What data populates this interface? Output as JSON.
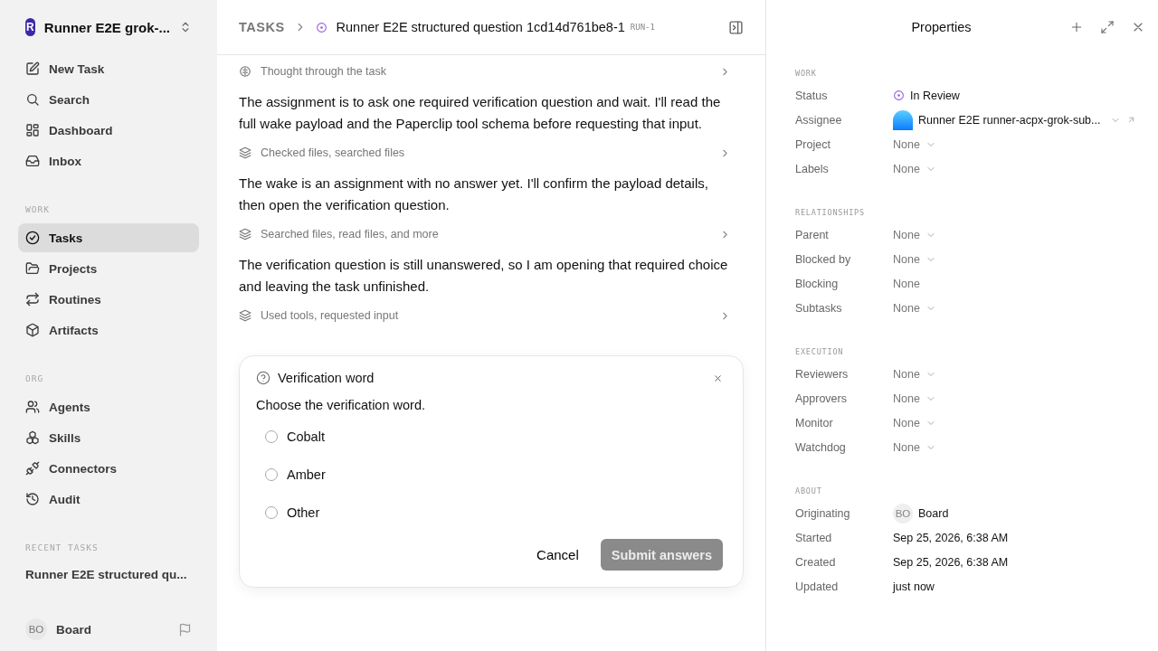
{
  "sidebar": {
    "workspace": {
      "initial": "R",
      "name": "Runner E2E grok-..."
    },
    "nav": [
      {
        "label": "New Task",
        "selected": false
      },
      {
        "label": "Search",
        "selected": false
      },
      {
        "label": "Dashboard",
        "selected": false
      },
      {
        "label": "Inbox",
        "selected": false
      }
    ],
    "sections": [
      {
        "title": "WORK",
        "items": [
          {
            "label": "Tasks",
            "selected": true
          },
          {
            "label": "Projects",
            "selected": false
          },
          {
            "label": "Routines",
            "selected": false
          },
          {
            "label": "Artifacts",
            "selected": false
          }
        ]
      },
      {
        "title": "ORG",
        "items": [
          {
            "label": "Agents",
            "selected": false
          },
          {
            "label": "Skills",
            "selected": false
          },
          {
            "label": "Connectors",
            "selected": false
          },
          {
            "label": "Audit",
            "selected": false
          }
        ]
      }
    ],
    "recent": {
      "title": "RECENT TASKS",
      "items": [
        {
          "label": "Runner E2E structured qu..."
        }
      ]
    },
    "user": {
      "initials": "BO",
      "name": "Board"
    }
  },
  "header": {
    "breadcrumb": "TASKS",
    "title": "Runner E2E structured question 1cd14d761be8-1",
    "run_id": "RUN-1"
  },
  "transcript": [
    {
      "kind": "thought",
      "label": "Thought through the task"
    },
    {
      "kind": "message",
      "text": "The assignment is to ask one required verification question and wait. I'll read the full wake payload and the Paperclip tool schema before requesting that input."
    },
    {
      "kind": "tools",
      "label": "Checked files, searched files"
    },
    {
      "kind": "message",
      "text": "The wake is an assignment with no answer yet. I'll confirm the payload details, then open the verification question."
    },
    {
      "kind": "tools",
      "label": "Searched files, read files, and more"
    },
    {
      "kind": "message",
      "text": "The verification question is still unanswered, so I am opening that required choice and leaving the task unfinished."
    },
    {
      "kind": "tools",
      "label": "Used tools, requested input"
    }
  ],
  "question": {
    "title": "Verification word",
    "prompt": "Choose the verification word.",
    "options": [
      {
        "label": "Cobalt",
        "selected": false
      },
      {
        "label": "Amber",
        "selected": false
      },
      {
        "label": "Other",
        "selected": false
      }
    ],
    "cancel": "Cancel",
    "submit": {
      "label": "Submit answers",
      "disabled": true
    }
  },
  "properties": {
    "title": "Properties",
    "sections": [
      {
        "title": "WORK",
        "rows": [
          {
            "label": "Status",
            "kind": "status",
            "value": "In Review"
          },
          {
            "label": "Assignee",
            "kind": "agent",
            "value": "Runner E2E runner-acpx-grok-sub..."
          },
          {
            "label": "Project",
            "kind": "select",
            "value": "None"
          },
          {
            "label": "Labels",
            "kind": "select",
            "value": "None"
          }
        ]
      },
      {
        "title": "RELATIONSHIPS",
        "rows": [
          {
            "label": "Parent",
            "kind": "select",
            "value": "None"
          },
          {
            "label": "Blocked by",
            "kind": "select",
            "value": "None"
          },
          {
            "label": "Blocking",
            "kind": "plain",
            "value": "None"
          },
          {
            "label": "Subtasks",
            "kind": "select",
            "value": "None"
          }
        ]
      },
      {
        "title": "EXECUTION",
        "rows": [
          {
            "label": "Reviewers",
            "kind": "select",
            "value": "None"
          },
          {
            "label": "Approvers",
            "kind": "select",
            "value": "None"
          },
          {
            "label": "Monitor",
            "kind": "select",
            "value": "None"
          },
          {
            "label": "Watchdog",
            "kind": "select",
            "value": "None"
          }
        ]
      },
      {
        "title": "ABOUT",
        "rows": [
          {
            "label": "Originating",
            "kind": "user",
            "initials": "BO",
            "value": "Board"
          },
          {
            "label": "Started",
            "kind": "text",
            "value": "Sep 25, 2026, 6:38 AM"
          },
          {
            "label": "Created",
            "kind": "text",
            "value": "Sep 25, 2026, 6:38 AM"
          },
          {
            "label": "Updated",
            "kind": "text",
            "value": "just now"
          }
        ]
      }
    ]
  }
}
